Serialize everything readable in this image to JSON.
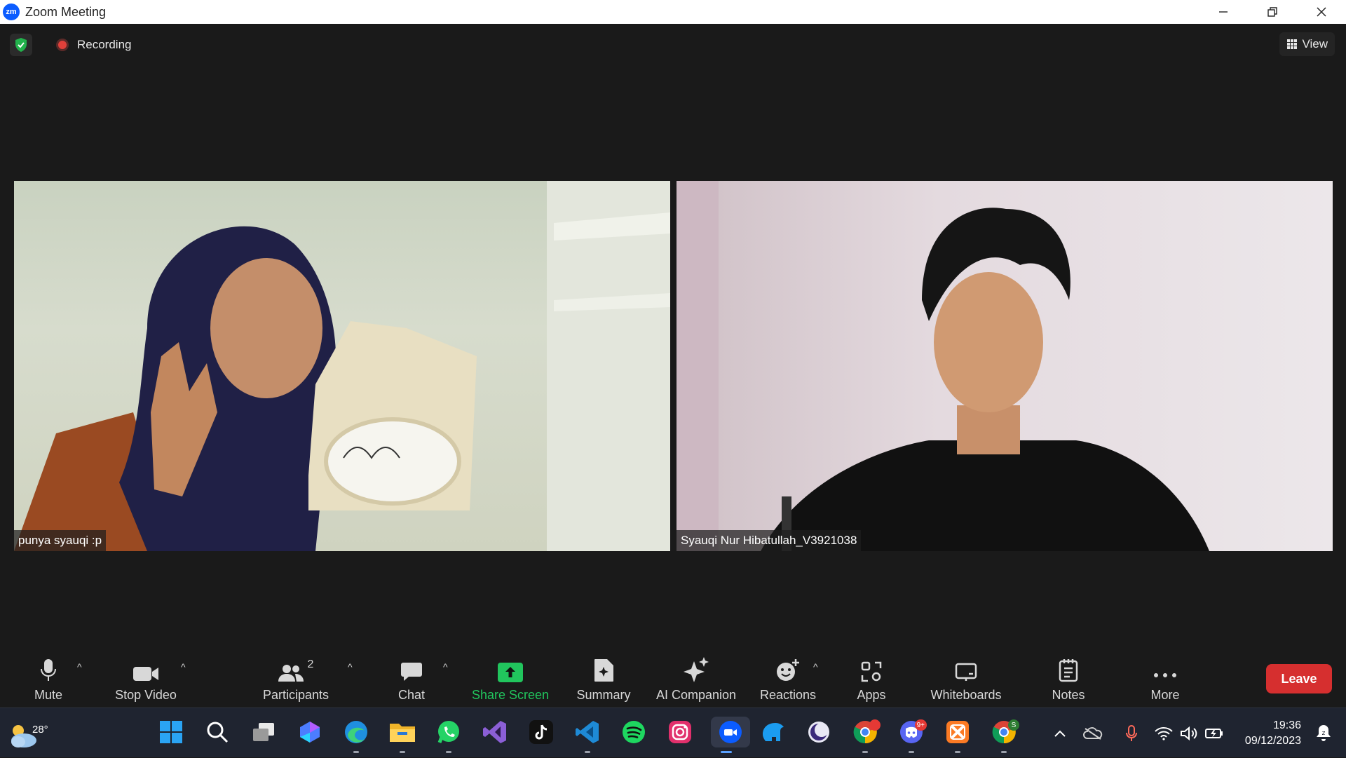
{
  "window": {
    "app_icon_text": "zm",
    "title": "Zoom Meeting"
  },
  "meeting": {
    "recording_label": "Recording",
    "view_label": "View",
    "participants": [
      {
        "name": "punya syauqi :p"
      },
      {
        "name": "Syauqi Nur Hibatullah_V3921038"
      }
    ]
  },
  "toolbar": {
    "mute": "Mute",
    "stop_video": "Stop Video",
    "participants": "Participants",
    "participants_count": "2",
    "chat": "Chat",
    "share_screen": "Share Screen",
    "summary": "Summary",
    "ai_companion": "AI Companion",
    "reactions": "Reactions",
    "apps": "Apps",
    "whiteboards": "Whiteboards",
    "notes": "Notes",
    "more": "More",
    "leave": "Leave",
    "share_color": "#21c55d",
    "leave_color": "#d62f2f"
  },
  "taskbar": {
    "temperature": "28°",
    "apps": [
      "start-icon",
      "search-icon",
      "task-view-icon",
      "copilot-icon",
      "edge-icon",
      "file-explorer-icon",
      "whatsapp-icon",
      "visual-studio-icon",
      "tiktok-icon",
      "vscode-icon",
      "spotify-icon",
      "instagram-icon",
      "zoom-icon",
      "dolphin-icon",
      "eclipse-icon",
      "chrome-icon",
      "discord-icon",
      "xampp-icon",
      "chrome-profile-icon"
    ],
    "discord_badge": "9+",
    "chrome_profile_badge": "S",
    "time": "19:36",
    "date": "09/12/2023"
  }
}
